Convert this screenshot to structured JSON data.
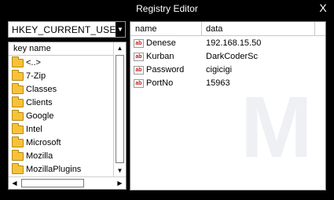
{
  "window": {
    "title": "Registry Editor",
    "close_glyph": "X"
  },
  "hive": {
    "value": "HKEY_CURRENT_USER",
    "dropdown_icon": "triangle-down-icon"
  },
  "tree": {
    "header": "key name",
    "items": [
      {
        "label": "<..>"
      },
      {
        "label": "7-Zip"
      },
      {
        "label": "Classes"
      },
      {
        "label": "Clients"
      },
      {
        "label": "Google"
      },
      {
        "label": "Intel"
      },
      {
        "label": "Microsoft"
      },
      {
        "label": "Mozilla"
      },
      {
        "label": "MozillaPlugins"
      }
    ]
  },
  "values": {
    "columns": {
      "name": "name",
      "data": "data"
    },
    "rows": [
      {
        "name": "Denese",
        "data": "192.168.15.50"
      },
      {
        "name": "Kurban",
        "data": "DarkCoderSc"
      },
      {
        "name": "Password",
        "data": "cigicigi"
      },
      {
        "name": "PortNo",
        "data": "15963"
      }
    ],
    "type_icon": "ab"
  },
  "colors": {
    "background": "#000000",
    "folder": "#f7c23a",
    "pane": "#ffffff"
  }
}
